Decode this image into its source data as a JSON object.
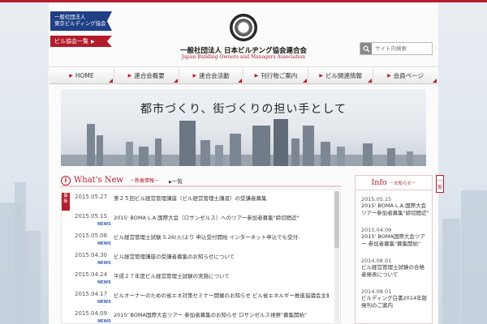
{
  "header": {
    "assoc_label": "一般社団法人 東京ビルディング協会",
    "assoc_label_line1": "一般社団法人",
    "assoc_label_line2": "東京ビルディング協会",
    "list_label": "ビル協会一覧",
    "org_name": "一般社団法人 日本ビルヂング協会連合会",
    "org_name_en": "Japan Building Owners and Managers Association",
    "search_placeholder": "サイト内検索"
  },
  "nav": {
    "items": [
      {
        "label": "HOME"
      },
      {
        "label": "連合会概要"
      },
      {
        "label": "連合会活動"
      },
      {
        "label": "刊行物ご案内"
      },
      {
        "label": "ビル関連情報"
      },
      {
        "label": "会員ページ"
      }
    ]
  },
  "hero": {
    "tagline": "都市づくり、街づくりの担い手として"
  },
  "news": {
    "title": "What's New",
    "subtitle": "－新着情報－",
    "all_label": "一覧",
    "recent_tab": "最新",
    "items": [
      {
        "date": "2015.05.27",
        "text": "第２５回ビル経営管理講座（ビル経営管理士講習）の受講者募集",
        "badge": ""
      },
      {
        "date": "2015.05.15",
        "text": "2015' BOMA L.A.国際大会（ロサンゼルス）へのツアー参加者募集\"締切間近\"",
        "badge": "NEWS"
      },
      {
        "date": "2015.05.08",
        "text": "ビル経営管理士試験 5.26(火)より 申込受付開始 インターネット申込でも受付-",
        "badge": "NEWS"
      },
      {
        "date": "2015.04.30",
        "text": "ビル経営管理講座の受講者募集のお知らせについて",
        "badge": "NEWS"
      },
      {
        "date": "2015.04.24",
        "text": "平成２７年度ビル経営管理士試験の実施について",
        "badge": "NEWS"
      },
      {
        "date": "2015.04.17",
        "text": "ビルオーナーのための省エネ対策セミナー開催のお知らせ ビル省エネルギー推進協議会主催",
        "badge": "NEWS"
      },
      {
        "date": "2015.04.09",
        "text": "2015' BOMA国際大会ツアー 参加者募集のお知らせ ロサンゼルス視察\"募集開始\"",
        "badge": "NEWS"
      }
    ]
  },
  "info": {
    "title": "Info",
    "subtitle": "－お知らせ－",
    "tab_label": "一覧",
    "items": [
      {
        "date": "2015.05.15",
        "text": "2015' BOMA L.A.国際大会ツアー参加者募集\"締切間近\""
      },
      {
        "date": "2015.04.09",
        "text": "2015' BOMA国際大会ツアー 参加者募集\"募集開始\""
      },
      {
        "date": "2014.08.01",
        "text": "ビル経営管理士試験の合格者発表について"
      },
      {
        "date": "2014.08.01",
        "text": "ビルディング白書2014年版発刊のご案内"
      }
    ]
  },
  "colors": {
    "accent_red": "#b31d2b",
    "navy": "#1f3f86",
    "news_badge": "#3a63b5"
  },
  "icons": {
    "search": "search-icon",
    "info": "info-icon",
    "logo": "association-seal-logo"
  }
}
